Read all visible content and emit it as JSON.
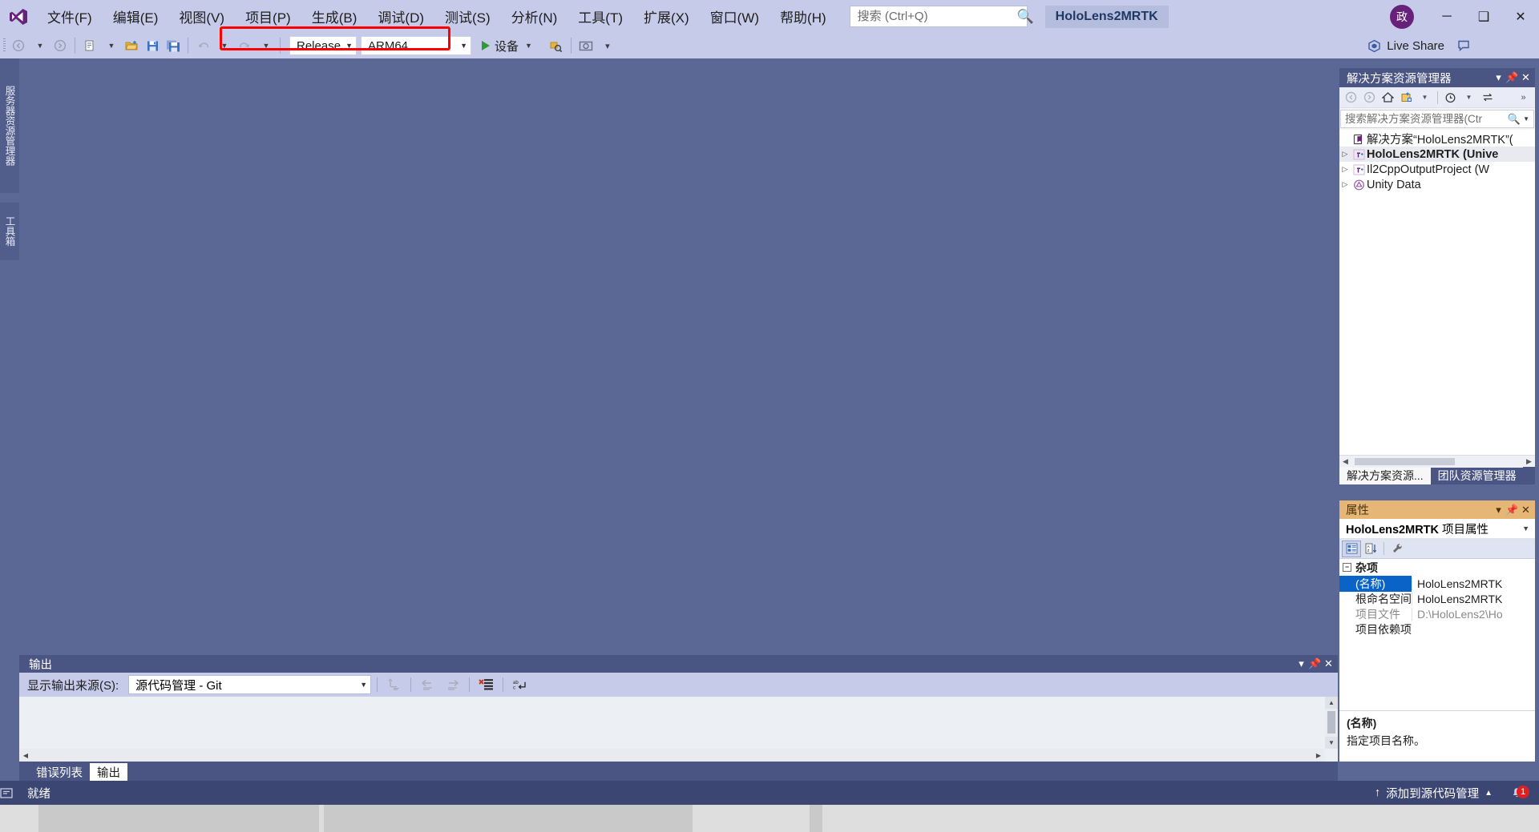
{
  "app": {
    "logo_icon": "visual-studio-logo",
    "project_chip": "HoloLens2MRTK",
    "user_badge": "政"
  },
  "menu": {
    "items": [
      {
        "label": "文件(F)",
        "name": "menu-file"
      },
      {
        "label": "编辑(E)",
        "name": "menu-edit"
      },
      {
        "label": "视图(V)",
        "name": "menu-view"
      },
      {
        "label": "项目(P)",
        "name": "menu-project"
      },
      {
        "label": "生成(B)",
        "name": "menu-build"
      },
      {
        "label": "调试(D)",
        "name": "menu-debug"
      },
      {
        "label": "测试(S)",
        "name": "menu-test"
      },
      {
        "label": "分析(N)",
        "name": "menu-analyze"
      },
      {
        "label": "工具(T)",
        "name": "menu-tools"
      },
      {
        "label": "扩展(X)",
        "name": "menu-extensions"
      },
      {
        "label": "窗口(W)",
        "name": "menu-window"
      },
      {
        "label": "帮助(H)",
        "name": "menu-help"
      }
    ]
  },
  "search": {
    "placeholder": "搜索 (Ctrl+Q)",
    "value": "",
    "icon": "search-icon"
  },
  "window_controls": {
    "minimize": "─",
    "maximize": "❑",
    "close": "✕"
  },
  "live_share": {
    "label": "Live Share",
    "icon": "live-share-icon"
  },
  "toolbar": {
    "nav_back": "◀",
    "nav_forward": "▶",
    "new_project_icon": "new-project-icon",
    "open_project_icon": "open-project-icon",
    "save_icon": "save-icon",
    "save_all_icon": "save-all-icon",
    "undo_icon": "undo-icon",
    "redo_icon": "redo-icon",
    "configuration": "Release",
    "platform": "ARM64",
    "run_target": "设备",
    "attach_icon": "attach-to-process-icon",
    "screenshot_icon": "screenshot-icon",
    "highlight_color": "#ff0000"
  },
  "left_rail": {
    "tabs": [
      {
        "label": "服务器资源管理器",
        "name": "rail-tab-server-explorer"
      },
      {
        "label": "工具箱",
        "name": "rail-tab-toolbox"
      }
    ]
  },
  "solution_explorer": {
    "title": "解决方案资源管理器",
    "title_buttons": {
      "dropdown": "▾",
      "pin": "⚔",
      "close": "✕"
    },
    "toolbar_icons": [
      "back-icon",
      "forward-icon",
      "home-icon",
      "show-all-files-icon",
      "dropdown-icon",
      "pending-changes-icon",
      "pending-dropdown-icon",
      "sync-icon",
      "overflow-icon"
    ],
    "search_placeholder": "搜索解决方案资源管理器(Ctr",
    "search_value": "",
    "tree": [
      {
        "label": "解决方案“HoloLens2MRTK”(",
        "icon": "solution-icon",
        "expander": "",
        "bold": false,
        "indent": 0
      },
      {
        "label": "HoloLens2MRTK (Unive",
        "icon": "cpp-project-icon",
        "expander": "▷",
        "bold": true,
        "indent": 0
      },
      {
        "label": "Il2CppOutputProject (W",
        "icon": "cpp-project-icon",
        "expander": "▷",
        "bold": false,
        "indent": 0
      },
      {
        "label": "Unity Data",
        "icon": "unity-folder-icon",
        "expander": "▷",
        "bold": false,
        "indent": 0
      }
    ],
    "tabs": [
      {
        "label": "解决方案资源...",
        "active": true,
        "name": "tab-solution-explorer"
      },
      {
        "label": "团队资源管理器",
        "active": false,
        "name": "tab-team-explorer"
      }
    ]
  },
  "properties": {
    "title": "属性",
    "title_buttons": {
      "dropdown": "▾",
      "pin": "⚔",
      "close": "✕"
    },
    "object_name": "HoloLens2MRTK",
    "object_kind": "项目属性",
    "toolbar_icons": [
      "categorized-icon",
      "alphabetical-icon",
      "property-pages-icon"
    ],
    "group": "杂项",
    "group_expander": "−",
    "rows": [
      {
        "key": "(名称)",
        "value": "HoloLens2MRTK",
        "selected": true,
        "readonly": false
      },
      {
        "key": "根命名空间",
        "value": "HoloLens2MRTK",
        "selected": false,
        "readonly": false
      },
      {
        "key": "项目文件",
        "value": "D:\\HoloLens2\\Ho",
        "selected": false,
        "readonly": true
      },
      {
        "key": "项目依赖项",
        "value": "",
        "selected": false,
        "readonly": false
      }
    ],
    "description_title": "(名称)",
    "description_body": "指定项目名称。"
  },
  "output": {
    "title": "输出",
    "title_buttons": {
      "dropdown": "▾",
      "pin": "⚔",
      "close": "✕"
    },
    "source_label": "显示输出来源(S):",
    "source_value": "源代码管理 - Git",
    "toolbar_icons": [
      "go-to-message-icon",
      "previous-message-icon",
      "next-message-icon",
      "clear-all-icon",
      "toggle-word-wrap-icon"
    ],
    "body_text": ""
  },
  "bottom_tabs": [
    {
      "label": "错误列表",
      "active": false,
      "name": "tab-error-list"
    },
    {
      "label": "输出",
      "active": true,
      "name": "tab-output"
    }
  ],
  "statusbar": {
    "icon": "ready-icon",
    "status": "就绪",
    "source_control_label": "添加到源代码管理",
    "source_control_arrow": "▲",
    "source_control_up": "↑",
    "notifications_count": "1",
    "bell_icon": "notification-bell-icon"
  }
}
